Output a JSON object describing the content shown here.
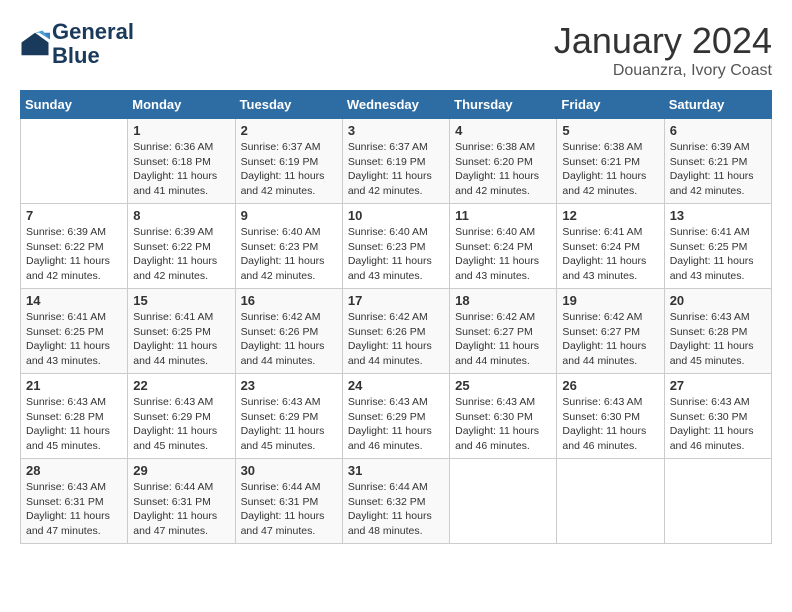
{
  "header": {
    "logo_line1": "General",
    "logo_line2": "Blue",
    "month": "January 2024",
    "location": "Douanzra, Ivory Coast"
  },
  "weekdays": [
    "Sunday",
    "Monday",
    "Tuesday",
    "Wednesday",
    "Thursday",
    "Friday",
    "Saturday"
  ],
  "weeks": [
    [
      {
        "day": "",
        "info": ""
      },
      {
        "day": "1",
        "info": "Sunrise: 6:36 AM\nSunset: 6:18 PM\nDaylight: 11 hours and 41 minutes."
      },
      {
        "day": "2",
        "info": "Sunrise: 6:37 AM\nSunset: 6:19 PM\nDaylight: 11 hours and 42 minutes."
      },
      {
        "day": "3",
        "info": "Sunrise: 6:37 AM\nSunset: 6:19 PM\nDaylight: 11 hours and 42 minutes."
      },
      {
        "day": "4",
        "info": "Sunrise: 6:38 AM\nSunset: 6:20 PM\nDaylight: 11 hours and 42 minutes."
      },
      {
        "day": "5",
        "info": "Sunrise: 6:38 AM\nSunset: 6:21 PM\nDaylight: 11 hours and 42 minutes."
      },
      {
        "day": "6",
        "info": "Sunrise: 6:39 AM\nSunset: 6:21 PM\nDaylight: 11 hours and 42 minutes."
      }
    ],
    [
      {
        "day": "7",
        "info": "Sunrise: 6:39 AM\nSunset: 6:22 PM\nDaylight: 11 hours and 42 minutes."
      },
      {
        "day": "8",
        "info": "Sunrise: 6:39 AM\nSunset: 6:22 PM\nDaylight: 11 hours and 42 minutes."
      },
      {
        "day": "9",
        "info": "Sunrise: 6:40 AM\nSunset: 6:23 PM\nDaylight: 11 hours and 42 minutes."
      },
      {
        "day": "10",
        "info": "Sunrise: 6:40 AM\nSunset: 6:23 PM\nDaylight: 11 hours and 43 minutes."
      },
      {
        "day": "11",
        "info": "Sunrise: 6:40 AM\nSunset: 6:24 PM\nDaylight: 11 hours and 43 minutes."
      },
      {
        "day": "12",
        "info": "Sunrise: 6:41 AM\nSunset: 6:24 PM\nDaylight: 11 hours and 43 minutes."
      },
      {
        "day": "13",
        "info": "Sunrise: 6:41 AM\nSunset: 6:25 PM\nDaylight: 11 hours and 43 minutes."
      }
    ],
    [
      {
        "day": "14",
        "info": "Sunrise: 6:41 AM\nSunset: 6:25 PM\nDaylight: 11 hours and 43 minutes."
      },
      {
        "day": "15",
        "info": "Sunrise: 6:41 AM\nSunset: 6:25 PM\nDaylight: 11 hours and 44 minutes."
      },
      {
        "day": "16",
        "info": "Sunrise: 6:42 AM\nSunset: 6:26 PM\nDaylight: 11 hours and 44 minutes."
      },
      {
        "day": "17",
        "info": "Sunrise: 6:42 AM\nSunset: 6:26 PM\nDaylight: 11 hours and 44 minutes."
      },
      {
        "day": "18",
        "info": "Sunrise: 6:42 AM\nSunset: 6:27 PM\nDaylight: 11 hours and 44 minutes."
      },
      {
        "day": "19",
        "info": "Sunrise: 6:42 AM\nSunset: 6:27 PM\nDaylight: 11 hours and 44 minutes."
      },
      {
        "day": "20",
        "info": "Sunrise: 6:43 AM\nSunset: 6:28 PM\nDaylight: 11 hours and 45 minutes."
      }
    ],
    [
      {
        "day": "21",
        "info": "Sunrise: 6:43 AM\nSunset: 6:28 PM\nDaylight: 11 hours and 45 minutes."
      },
      {
        "day": "22",
        "info": "Sunrise: 6:43 AM\nSunset: 6:29 PM\nDaylight: 11 hours and 45 minutes."
      },
      {
        "day": "23",
        "info": "Sunrise: 6:43 AM\nSunset: 6:29 PM\nDaylight: 11 hours and 45 minutes."
      },
      {
        "day": "24",
        "info": "Sunrise: 6:43 AM\nSunset: 6:29 PM\nDaylight: 11 hours and 46 minutes."
      },
      {
        "day": "25",
        "info": "Sunrise: 6:43 AM\nSunset: 6:30 PM\nDaylight: 11 hours and 46 minutes."
      },
      {
        "day": "26",
        "info": "Sunrise: 6:43 AM\nSunset: 6:30 PM\nDaylight: 11 hours and 46 minutes."
      },
      {
        "day": "27",
        "info": "Sunrise: 6:43 AM\nSunset: 6:30 PM\nDaylight: 11 hours and 46 minutes."
      }
    ],
    [
      {
        "day": "28",
        "info": "Sunrise: 6:43 AM\nSunset: 6:31 PM\nDaylight: 11 hours and 47 minutes."
      },
      {
        "day": "29",
        "info": "Sunrise: 6:44 AM\nSunset: 6:31 PM\nDaylight: 11 hours and 47 minutes."
      },
      {
        "day": "30",
        "info": "Sunrise: 6:44 AM\nSunset: 6:31 PM\nDaylight: 11 hours and 47 minutes."
      },
      {
        "day": "31",
        "info": "Sunrise: 6:44 AM\nSunset: 6:32 PM\nDaylight: 11 hours and 48 minutes."
      },
      {
        "day": "",
        "info": ""
      },
      {
        "day": "",
        "info": ""
      },
      {
        "day": "",
        "info": ""
      }
    ]
  ]
}
